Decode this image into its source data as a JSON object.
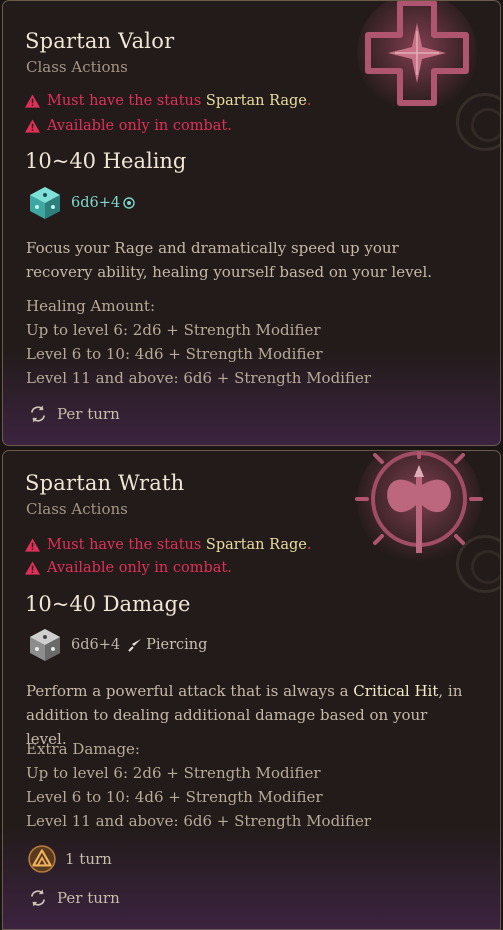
{
  "cards": [
    {
      "title": "Spartan Valor",
      "subtitle": "Class Actions",
      "requirements": [
        {
          "prefix": "Must have the status ",
          "status": "Spartan Rage",
          "suffix": "."
        },
        {
          "text": "Available only in combat."
        }
      ],
      "effect": "10~40 Healing",
      "dice": "6d6+4",
      "description": "Focus your Rage and dramatically speed up your recovery ability, healing yourself based on your level.",
      "scaling_header": "Healing Amount:",
      "scaling": [
        "Up to level 6: 2d6 + Strength Modifier",
        "Level 6 to 10: 4d6 + Strength Modifier",
        "Level 11 and above: 6d6 + Strength Modifier"
      ],
      "resource": "Per turn",
      "icons": {
        "emblem": "cross-star-emblem-icon",
        "die": "teal-die-icon",
        "resource": "recharge-per-turn-icon"
      }
    },
    {
      "title": "Spartan Wrath",
      "subtitle": "Class Actions",
      "requirements": [
        {
          "prefix": "Must have the status ",
          "status": "Spartan Rage",
          "suffix": "."
        },
        {
          "text": "Available only in combat."
        }
      ],
      "effect": "10~40 Damage",
      "dice": "6d6+4",
      "damage_type": "Piercing",
      "description_before": "Perform a powerful attack that is always a ",
      "description_highlight": "Critical Hit",
      "description_after": ", in addition to dealing additional damage based on your level.",
      "scaling_header": "Extra Damage:",
      "scaling": [
        "Up to level 6: 2d6 + Strength Modifier",
        "Level 6 to 10: 4d6 + Strength Modifier",
        "Level 11 and above: 6d6 + Strength Modifier"
      ],
      "cooldown": "1 turn",
      "resource": "Per turn",
      "icons": {
        "emblem": "axe-sunburst-emblem-icon",
        "die": "grey-die-icon",
        "damage": "piercing-icon",
        "cooldown": "cooldown-icon",
        "resource": "recharge-per-turn-icon"
      }
    }
  ],
  "colors": {
    "warning": "#e0305a",
    "status": "#e9dca2",
    "heal": "#7fd6cd",
    "highlight": "#f4ecc8"
  }
}
